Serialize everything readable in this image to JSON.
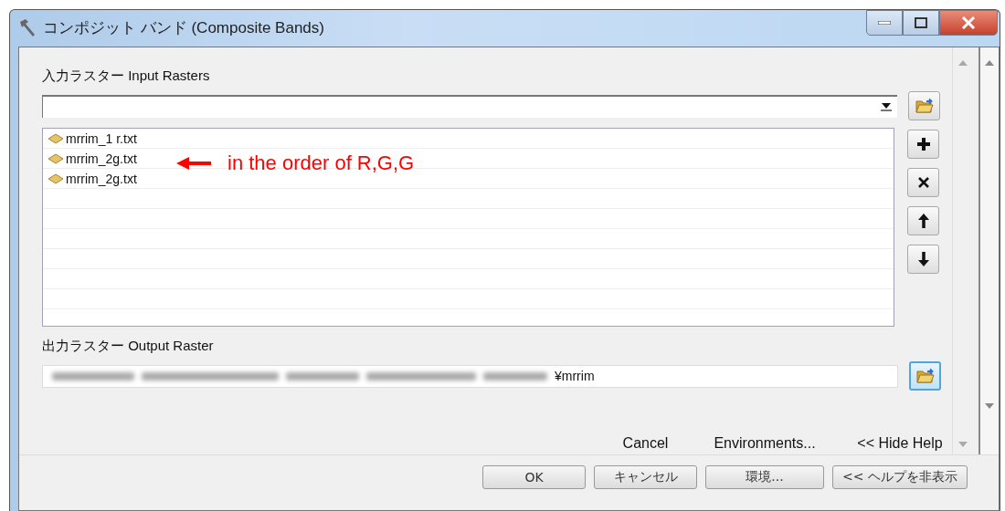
{
  "window": {
    "title": "コンポジット バンド (Composite Bands)"
  },
  "input_rasters": {
    "label": "入力ラスター Input Rasters",
    "items": [
      {
        "name": "mrrim_1 r.txt"
      },
      {
        "name": "mrrim_2g.txt"
      },
      {
        "name": "mrrim_2g.txt"
      }
    ]
  },
  "annotation": {
    "text": "in the order of R,G,G"
  },
  "output_raster": {
    "label": "出力ラスター Output Raster",
    "value": "¥mrrim"
  },
  "button_captions": [
    "Cancel",
    "Environments...",
    "<< Hide Help"
  ],
  "buttons": [
    "OK",
    "キャンセル",
    "環境...",
    "<< ヘルプを非表示"
  ]
}
